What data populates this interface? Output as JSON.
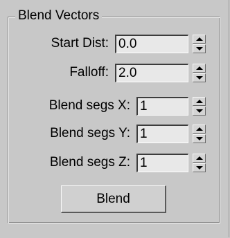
{
  "group": {
    "title": "Blend Vectors"
  },
  "params": [
    {
      "label": "Start Dist:",
      "value": "0.0"
    },
    {
      "label": "Falloff:",
      "value": "2.0"
    },
    {
      "label": "Blend segs X:",
      "value": "1"
    },
    {
      "label": "Blend segs Y:",
      "value": "1"
    },
    {
      "label": "Blend segs Z:",
      "value": "1"
    }
  ],
  "actions": {
    "blend_label": "Blend"
  }
}
